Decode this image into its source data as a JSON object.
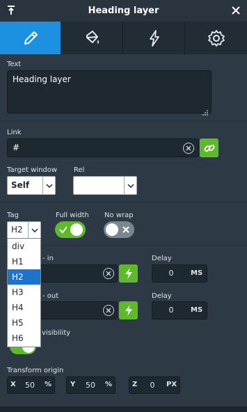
{
  "window": {
    "title": "Heading layer"
  },
  "tabs": [
    {
      "icon": "pencil-icon",
      "active": true
    },
    {
      "icon": "paint-bucket-icon",
      "active": false
    },
    {
      "icon": "lightning-icon",
      "active": false
    },
    {
      "icon": "gear-icon",
      "active": false
    }
  ],
  "text_section": {
    "label": "Text",
    "value": "Heading layer"
  },
  "link_section": {
    "label": "Link",
    "value": "#"
  },
  "target_window": {
    "label": "Target window",
    "value": "Self"
  },
  "rel": {
    "label": "Rel",
    "value": ""
  },
  "tag": {
    "label": "Tag",
    "value": "H2",
    "options": [
      "div",
      "H1",
      "H2",
      "H3",
      "H4",
      "H5",
      "H6"
    ],
    "selected_index": 2
  },
  "full_width": {
    "label": "Full width",
    "on": true
  },
  "no_wrap": {
    "label": "No wrap",
    "on": false
  },
  "animation_in": {
    "label_fragment": "- in",
    "delay_label": "Delay",
    "delay_value": "0",
    "delay_unit": "MS"
  },
  "animation_out": {
    "label_fragment": "- out",
    "delay_label": "Delay",
    "delay_value": "0",
    "delay_unit": "MS"
  },
  "visibility": {
    "label_fragment": "visibility"
  },
  "transform_origin": {
    "label": "Transform origin",
    "x": {
      "axis": "X",
      "value": "50",
      "unit": "%"
    },
    "y": {
      "axis": "Y",
      "value": "50",
      "unit": "%"
    },
    "z": {
      "axis": "Z",
      "value": "0",
      "unit": "PX"
    }
  },
  "colors": {
    "accent": "#1d90e0",
    "green": "#5dbb2a",
    "panel": "#2d3a45"
  }
}
